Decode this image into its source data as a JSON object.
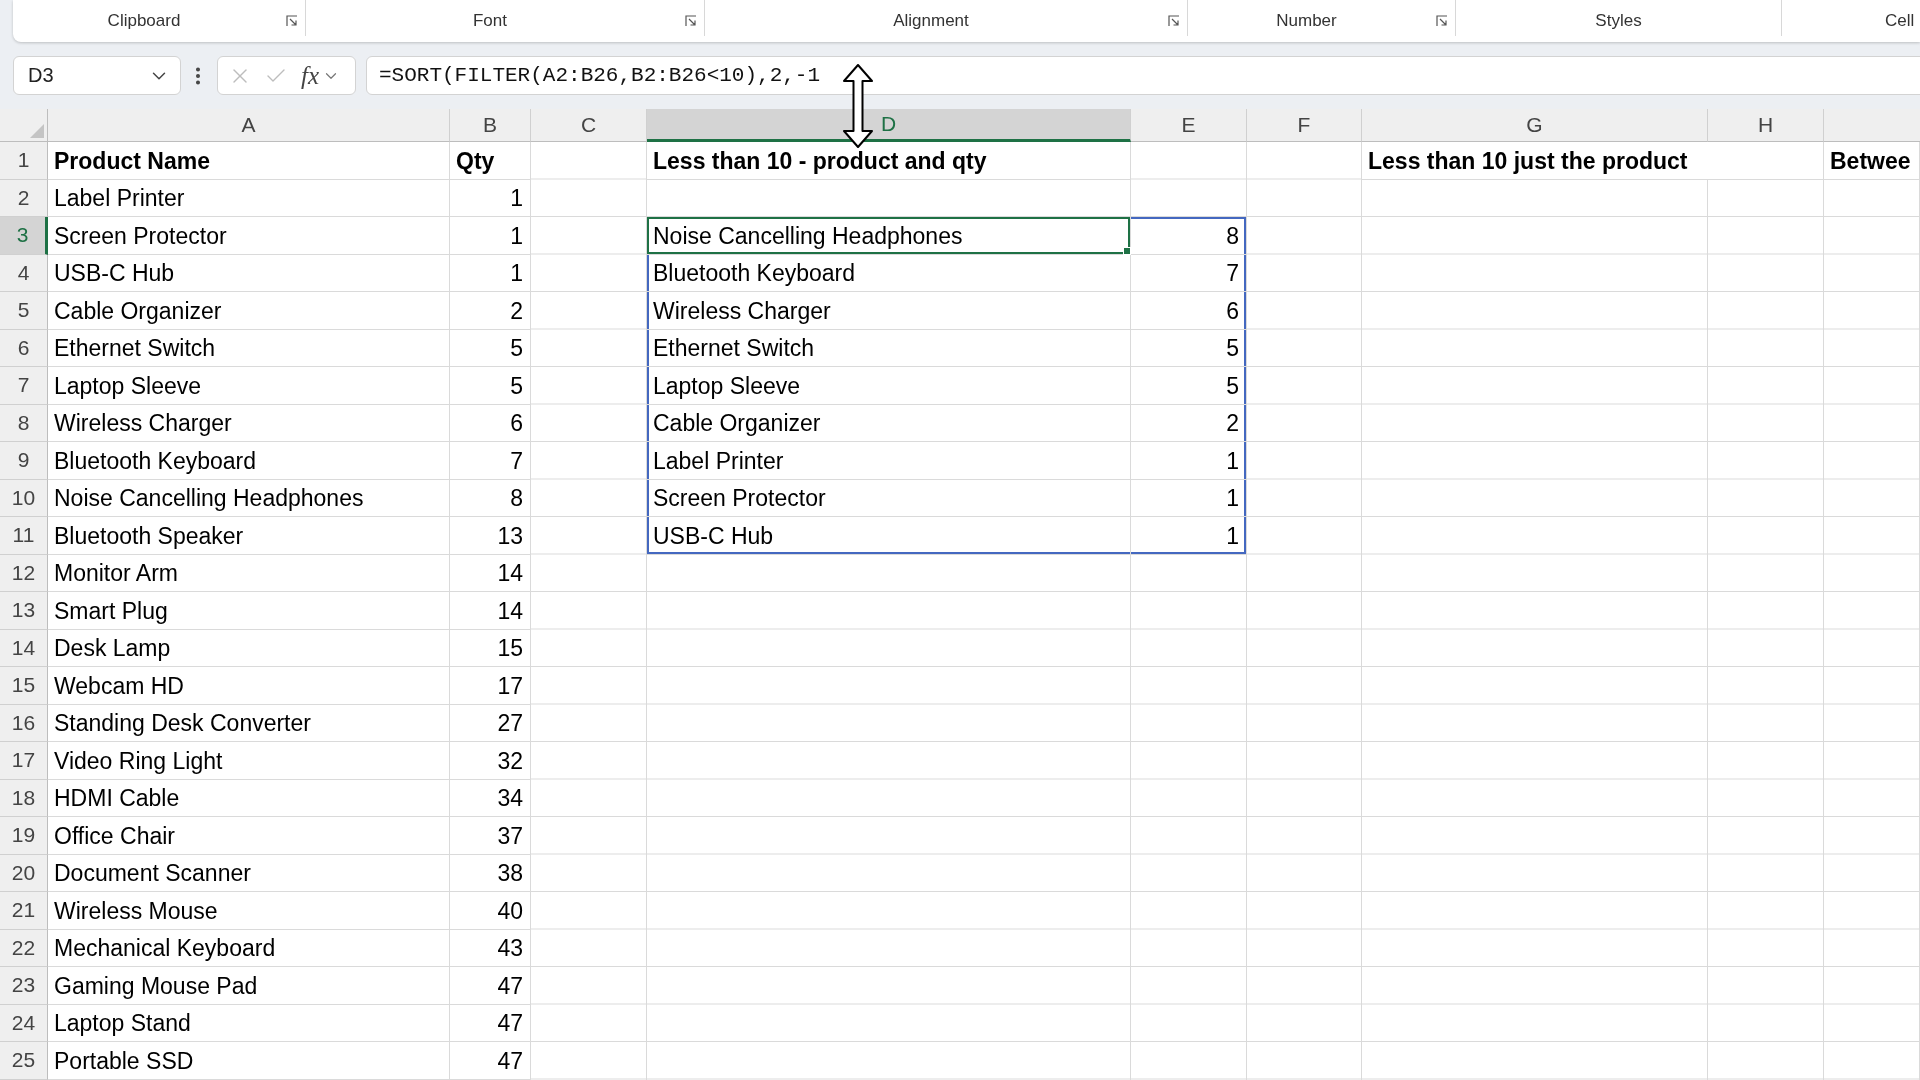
{
  "ribbon": {
    "groups": [
      {
        "label": "Clipboard",
        "launcher": true
      },
      {
        "label": "Font",
        "launcher": true
      },
      {
        "label": "Alignment",
        "launcher": true
      },
      {
        "label": "Number",
        "launcher": true
      },
      {
        "label": "Styles",
        "launcher": false
      },
      {
        "label": "Cell",
        "launcher": false
      }
    ]
  },
  "formula_bar": {
    "name_box": "D3",
    "buttons": [
      {
        "kind": "cancel",
        "disabled": true
      },
      {
        "kind": "enter",
        "disabled": true
      },
      {
        "kind": "function",
        "label": "fx",
        "disabled": false
      }
    ],
    "formula": "=SORT(FILTER(A2:B26,B2:B26<10),2,-1"
  },
  "sheet": {
    "columns": [
      {
        "label": "A",
        "selected": false
      },
      {
        "label": "B",
        "selected": false
      },
      {
        "label": "C",
        "selected": false
      },
      {
        "label": "D",
        "selected": true
      },
      {
        "label": "E",
        "selected": false
      },
      {
        "label": "F",
        "selected": false
      },
      {
        "label": "G",
        "selected": false
      },
      {
        "label": "H",
        "selected": false
      }
    ],
    "rows": [
      {
        "number": "1",
        "selected": false,
        "cells": {
          "A": {
            "kind": "heading",
            "text": "Product Name",
            "spill": false
          },
          "B": {
            "kind": "heading",
            "text": "Qty",
            "spill": false
          },
          "D": {
            "kind": "heading",
            "text": "Less than 10 - product and qty",
            "spill": false
          },
          "G": {
            "kind": "heading",
            "text": "Less than 10 just the product",
            "spill": false
          },
          "I": {
            "kind": "heading",
            "text": "Betwee",
            "spill": false
          }
        }
      },
      {
        "number": "2",
        "selected": false,
        "cells": {
          "A": {
            "kind": "text",
            "text": "Label Printer",
            "spill": false
          },
          "B": {
            "kind": "number",
            "text": "1",
            "spill": false
          }
        }
      },
      {
        "number": "3",
        "selected": true,
        "cells": {
          "A": {
            "kind": "text",
            "text": "Screen Protector",
            "spill": false
          },
          "B": {
            "kind": "number",
            "text": "1",
            "spill": false
          },
          "D": {
            "kind": "text",
            "text": "Noise Cancelling Headphones",
            "spill": true
          },
          "E": {
            "kind": "number",
            "text": "8",
            "spill": true
          }
        }
      },
      {
        "number": "4",
        "selected": false,
        "cells": {
          "A": {
            "kind": "text",
            "text": "USB-C Hub",
            "spill": false
          },
          "B": {
            "kind": "number",
            "text": "1",
            "spill": false
          },
          "D": {
            "kind": "text",
            "text": "Bluetooth Keyboard",
            "spill": true
          },
          "E": {
            "kind": "number",
            "text": "7",
            "spill": true
          }
        }
      },
      {
        "number": "5",
        "selected": false,
        "cells": {
          "A": {
            "kind": "text",
            "text": "Cable Organizer",
            "spill": false
          },
          "B": {
            "kind": "number",
            "text": "2",
            "spill": false
          },
          "D": {
            "kind": "text",
            "text": "Wireless Charger",
            "spill": true
          },
          "E": {
            "kind": "number",
            "text": "6",
            "spill": true
          }
        }
      },
      {
        "number": "6",
        "selected": false,
        "cells": {
          "A": {
            "kind": "text",
            "text": "Ethernet Switch",
            "spill": false
          },
          "B": {
            "kind": "number",
            "text": "5",
            "spill": false
          },
          "D": {
            "kind": "text",
            "text": "Ethernet Switch",
            "spill": true
          },
          "E": {
            "kind": "number",
            "text": "5",
            "spill": true
          }
        }
      },
      {
        "number": "7",
        "selected": false,
        "cells": {
          "A": {
            "kind": "text",
            "text": "Laptop Sleeve",
            "spill": false
          },
          "B": {
            "kind": "number",
            "text": "5",
            "spill": false
          },
          "D": {
            "kind": "text",
            "text": "Laptop Sleeve",
            "spill": true
          },
          "E": {
            "kind": "number",
            "text": "5",
            "spill": true
          }
        }
      },
      {
        "number": "8",
        "selected": false,
        "cells": {
          "A": {
            "kind": "text",
            "text": "Wireless Charger",
            "spill": false
          },
          "B": {
            "kind": "number",
            "text": "6",
            "spill": false
          },
          "D": {
            "kind": "text",
            "text": "Cable Organizer",
            "spill": true
          },
          "E": {
            "kind": "number",
            "text": "2",
            "spill": true
          }
        }
      },
      {
        "number": "9",
        "selected": false,
        "cells": {
          "A": {
            "kind": "text",
            "text": "Bluetooth Keyboard",
            "spill": false
          },
          "B": {
            "kind": "number",
            "text": "7",
            "spill": false
          },
          "D": {
            "kind": "text",
            "text": "Label Printer",
            "spill": true
          },
          "E": {
            "kind": "number",
            "text": "1",
            "spill": true
          }
        }
      },
      {
        "number": "10",
        "selected": false,
        "cells": {
          "A": {
            "kind": "text",
            "text": "Noise Cancelling Headphones",
            "spill": false
          },
          "B": {
            "kind": "number",
            "text": "8",
            "spill": false
          },
          "D": {
            "kind": "text",
            "text": "Screen Protector",
            "spill": true
          },
          "E": {
            "kind": "number",
            "text": "1",
            "spill": true
          }
        }
      },
      {
        "number": "11",
        "selected": false,
        "cells": {
          "A": {
            "kind": "text",
            "text": "Bluetooth Speaker",
            "spill": false
          },
          "B": {
            "kind": "number",
            "text": "13",
            "spill": false
          },
          "D": {
            "kind": "text",
            "text": "USB-C Hub",
            "spill": true
          },
          "E": {
            "kind": "number",
            "text": "1",
            "spill": true
          }
        }
      },
      {
        "number": "12",
        "selected": false,
        "cells": {
          "A": {
            "kind": "text",
            "text": "Monitor Arm",
            "spill": false
          },
          "B": {
            "kind": "number",
            "text": "14",
            "spill": false
          }
        }
      },
      {
        "number": "13",
        "selected": false,
        "cells": {
          "A": {
            "kind": "text",
            "text": "Smart Plug",
            "spill": false
          },
          "B": {
            "kind": "number",
            "text": "14",
            "spill": false
          }
        }
      },
      {
        "number": "14",
        "selected": false,
        "cells": {
          "A": {
            "kind": "text",
            "text": "Desk Lamp",
            "spill": false
          },
          "B": {
            "kind": "number",
            "text": "15",
            "spill": false
          }
        }
      },
      {
        "number": "15",
        "selected": false,
        "cells": {
          "A": {
            "kind": "text",
            "text": "Webcam HD",
            "spill": false
          },
          "B": {
            "kind": "number",
            "text": "17",
            "spill": false
          }
        }
      },
      {
        "number": "16",
        "selected": false,
        "cells": {
          "A": {
            "kind": "text",
            "text": "Standing Desk Converter",
            "spill": false
          },
          "B": {
            "kind": "number",
            "text": "27",
            "spill": false
          }
        }
      },
      {
        "number": "17",
        "selected": false,
        "cells": {
          "A": {
            "kind": "text",
            "text": "Video Ring Light",
            "spill": false
          },
          "B": {
            "kind": "number",
            "text": "32",
            "spill": false
          }
        }
      },
      {
        "number": "18",
        "selected": false,
        "cells": {
          "A": {
            "kind": "text",
            "text": "HDMI Cable",
            "spill": false
          },
          "B": {
            "kind": "number",
            "text": "34",
            "spill": false
          }
        }
      },
      {
        "number": "19",
        "selected": false,
        "cells": {
          "A": {
            "kind": "text",
            "text": "Office Chair",
            "spill": false
          },
          "B": {
            "kind": "number",
            "text": "37",
            "spill": false
          }
        }
      },
      {
        "number": "20",
        "selected": false,
        "cells": {
          "A": {
            "kind": "text",
            "text": "Document Scanner",
            "spill": false
          },
          "B": {
            "kind": "number",
            "text": "38",
            "spill": false
          }
        }
      },
      {
        "number": "21",
        "selected": false,
        "cells": {
          "A": {
            "kind": "text",
            "text": "Wireless Mouse",
            "spill": false
          },
          "B": {
            "kind": "number",
            "text": "40",
            "spill": false
          }
        }
      },
      {
        "number": "22",
        "selected": false,
        "cells": {
          "A": {
            "kind": "text",
            "text": "Mechanical Keyboard",
            "spill": false
          },
          "B": {
            "kind": "number",
            "text": "43",
            "spill": false
          }
        }
      },
      {
        "number": "23",
        "selected": false,
        "cells": {
          "A": {
            "kind": "text",
            "text": "Gaming Mouse Pad",
            "spill": false
          },
          "B": {
            "kind": "number",
            "text": "47",
            "spill": false
          }
        }
      },
      {
        "number": "24",
        "selected": false,
        "cells": {
          "A": {
            "kind": "text",
            "text": "Laptop Stand",
            "spill": false
          },
          "B": {
            "kind": "number",
            "text": "47",
            "spill": false
          }
        }
      },
      {
        "number": "25",
        "selected": false,
        "cells": {
          "A": {
            "kind": "text",
            "text": "Portable SSD",
            "spill": false
          },
          "B": {
            "kind": "number",
            "text": "47",
            "spill": false
          }
        }
      }
    ]
  }
}
